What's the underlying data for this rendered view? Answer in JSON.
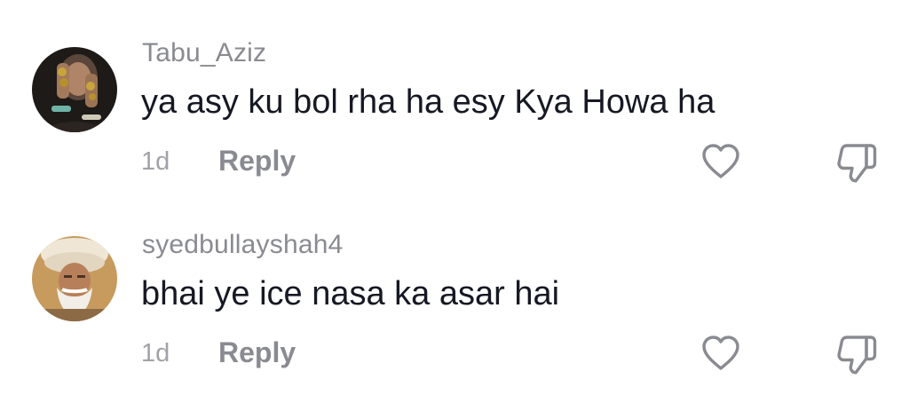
{
  "comments": [
    {
      "username": "Tabu_Aziz",
      "text": "ya asy ku bol rha ha esy Kya Howa ha",
      "time": "1d",
      "reply_label": "Reply",
      "avatar": "woman-hands-photo",
      "like_icon": "heart-outline-icon",
      "dislike_icon": "thumbs-down-outline-icon"
    },
    {
      "username": "syedbullayshah4",
      "text": "bhai ye ice nasa ka asar hai",
      "time": "1d",
      "reply_label": "Reply",
      "avatar": "elder-turban-portrait",
      "like_icon": "heart-outline-icon",
      "dislike_icon": "thumbs-down-outline-icon"
    }
  ],
  "colors": {
    "username": "#8a8b91",
    "text": "#161823",
    "meta": "#a1a2a7",
    "icon": "#8a8b91"
  }
}
